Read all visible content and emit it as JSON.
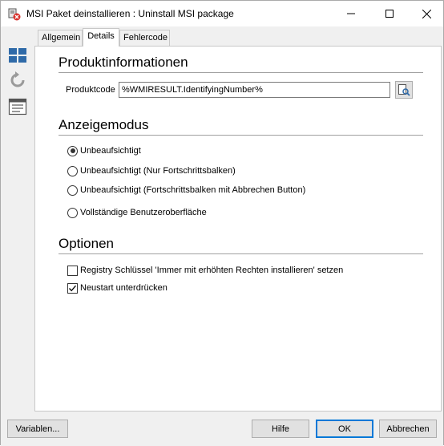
{
  "window": {
    "title": "MSI Paket deinstallieren : Uninstall MSI package"
  },
  "sidebar": {
    "icons": [
      "grid-icon",
      "refresh-icon",
      "list-icon"
    ]
  },
  "tabs": [
    {
      "label": "Allgemein",
      "active": false
    },
    {
      "label": "Details",
      "active": true
    },
    {
      "label": "Fehlercode",
      "active": false
    }
  ],
  "product_info": {
    "heading": "Produktinformationen",
    "code_label": "Produktcode",
    "code_value": "%WMIRESULT.IdentifyingNumber%"
  },
  "display_mode": {
    "heading": "Anzeigemodus",
    "options": [
      {
        "label": "Unbeaufsichtigt",
        "selected": true
      },
      {
        "label": "Unbeaufsichtigt (Nur Fortschrittsbalken)",
        "selected": false
      },
      {
        "label": "Unbeaufsichtigt (Fortschrittsbalken mit Abbrechen Button)",
        "selected": false
      },
      {
        "label": "Vollständige Benutzeroberfläche",
        "selected": false
      }
    ]
  },
  "options": {
    "heading": "Optionen",
    "items": [
      {
        "label": "Registry Schlüssel 'Immer mit erhöhten Rechten installieren' setzen",
        "checked": false
      },
      {
        "label": "Neustart unterdrücken",
        "checked": true
      }
    ]
  },
  "buttons": {
    "variables": "Variablen...",
    "help": "Hilfe",
    "ok": "OK",
    "cancel": "Abbrechen"
  },
  "colors": {
    "accent": "#0078d7",
    "sidebar_icon": "#2f6aa8"
  }
}
